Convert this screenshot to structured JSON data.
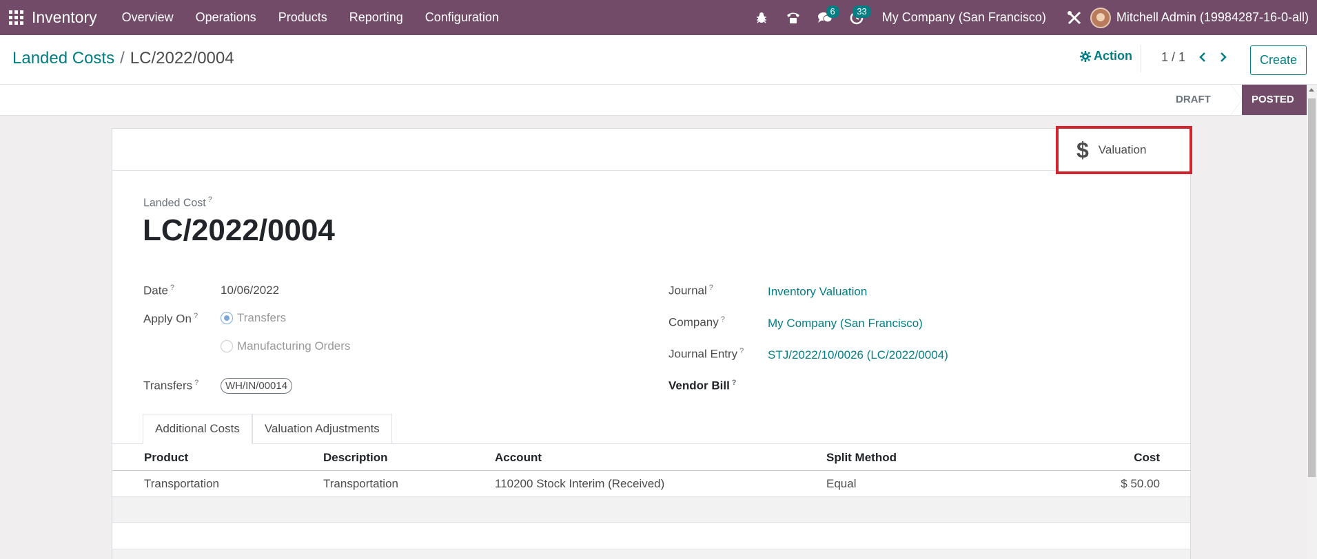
{
  "navbar": {
    "app_name": "Inventory",
    "menu": [
      "Overview",
      "Operations",
      "Products",
      "Reporting",
      "Configuration"
    ],
    "messages_count": "6",
    "activities_count": "33",
    "company": "My Company (San Francisco)",
    "user": "Mitchell Admin (19984287-16-0-all)",
    "color": "#714b67"
  },
  "breadcrumb": {
    "parent": "Landed Costs",
    "separator": "/",
    "current": "LC/2022/0004"
  },
  "control": {
    "action_label": "Action",
    "pager": "1 / 1",
    "create_label": "Create"
  },
  "status": {
    "stages": [
      "DRAFT",
      "POSTED"
    ],
    "current": "POSTED"
  },
  "sheet": {
    "valuation_label": "Valuation",
    "name_label": "Landed Cost",
    "help_mark": "?",
    "record_name": "LC/2022/0004",
    "date_label": "Date",
    "date_value": "10/06/2022",
    "apply_on_label": "Apply On",
    "apply_on_options": [
      "Transfers",
      "Manufacturing Orders"
    ],
    "apply_on_selected": "Transfers",
    "transfers_label": "Transfers",
    "transfers_tag": "WH/IN/00014",
    "journal_label": "Journal",
    "journal_value": "Inventory Valuation",
    "company_label": "Company",
    "company_value": "My Company (San Francisco)",
    "journal_entry_label": "Journal Entry",
    "journal_entry_value": "STJ/2022/10/0026 (LC/2022/0004)",
    "vendor_bill_label": "Vendor Bill"
  },
  "tabs": [
    "Additional Costs",
    "Valuation Adjustments"
  ],
  "table": {
    "columns": [
      "Product",
      "Description",
      "Account",
      "Split Method",
      "Cost"
    ],
    "rows": [
      [
        "Transportation",
        "Transportation",
        "110200 Stock Interim (Received)",
        "Equal",
        "$ 50.00"
      ]
    ]
  },
  "colors": {
    "accent": "#017e84",
    "highlight_box": "#d0252d"
  }
}
